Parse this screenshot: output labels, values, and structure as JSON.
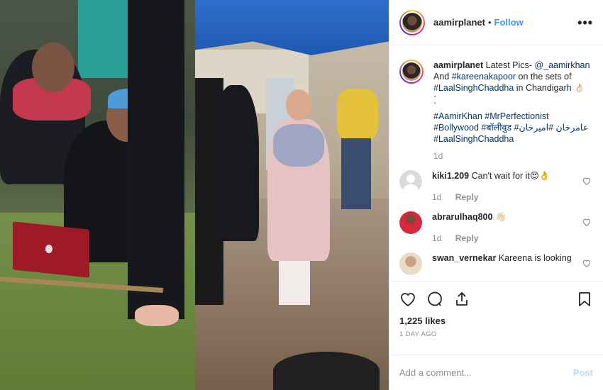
{
  "header": {
    "username": "aamirplanet",
    "separator": "•",
    "follow_label": "Follow",
    "more_label": "•••"
  },
  "caption": {
    "username": "aamirplanet",
    "line1_text": "Latest Pics- ",
    "line1_mention": "@_aamirkhan",
    "line2_text": "And ",
    "line2_mention": "#kareenakapoor",
    "line2_rest": " on the sets of",
    "line3_tag": "#LaalSinghChaddha",
    "line3_rest": " in Chandigarh 👌🏻",
    "dots": [
      "·",
      "·"
    ],
    "hashtags": [
      "#AamirKhan #MrPerfectionist",
      "#Bollywood #बॉलीवुड #عامرخان #امیرخان",
      "#LaalSinghChaddha"
    ],
    "time": "1d"
  },
  "comments": [
    {
      "username": "kiki1.209",
      "text": "Can't wait for it😍👌",
      "time": "1d",
      "reply_label": "Reply"
    },
    {
      "username": "abrarulhaq800",
      "text": "👋🏻",
      "time": "1d",
      "reply_label": "Reply"
    },
    {
      "username": "swan_vernekar",
      "text": "Kareena is looking"
    }
  ],
  "actions": {
    "likes": "1,225 likes",
    "date": "1 DAY AGO"
  },
  "composer": {
    "placeholder": "Add a comment...",
    "post_label": "Post"
  },
  "colors": {
    "link": "#00376b",
    "follow": "#3897f0",
    "post_disabled": "#b2dffc",
    "muted": "#8e8e8e"
  }
}
